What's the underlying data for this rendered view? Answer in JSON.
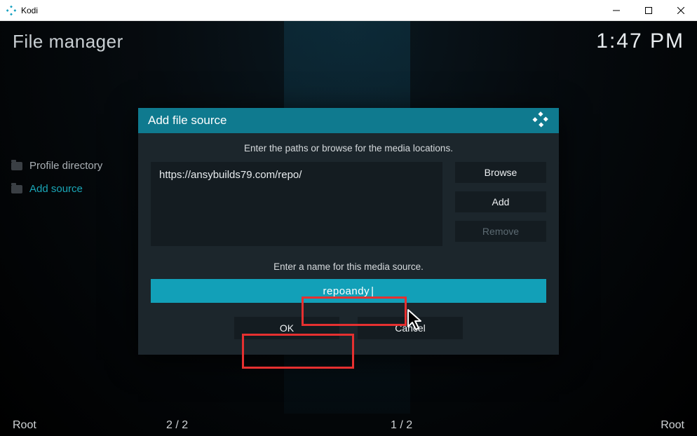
{
  "window": {
    "app_name": "Kodi"
  },
  "header": {
    "title": "File manager",
    "clock": "1:47 PM"
  },
  "sidebar": {
    "items": [
      {
        "label": "Profile directory",
        "active": false
      },
      {
        "label": "Add source",
        "active": true
      }
    ]
  },
  "status": {
    "left": "Root",
    "counter_left": "2 / 2",
    "counter_right": "1 / 2",
    "right": "Root"
  },
  "dialog": {
    "title": "Add file source",
    "instruction": "Enter the paths or browse for the media locations.",
    "path_value": "https://ansybuilds79.com/repo/",
    "buttons": {
      "browse": "Browse",
      "add": "Add",
      "remove": "Remove"
    },
    "name_label": "Enter a name for this media source.",
    "name_value": "repoandy",
    "actions": {
      "ok": "OK",
      "cancel": "Cancel"
    }
  },
  "colors": {
    "accent": "#0f7a8f",
    "accent_light": "#12a0b8",
    "highlight_red": "#e63030"
  }
}
